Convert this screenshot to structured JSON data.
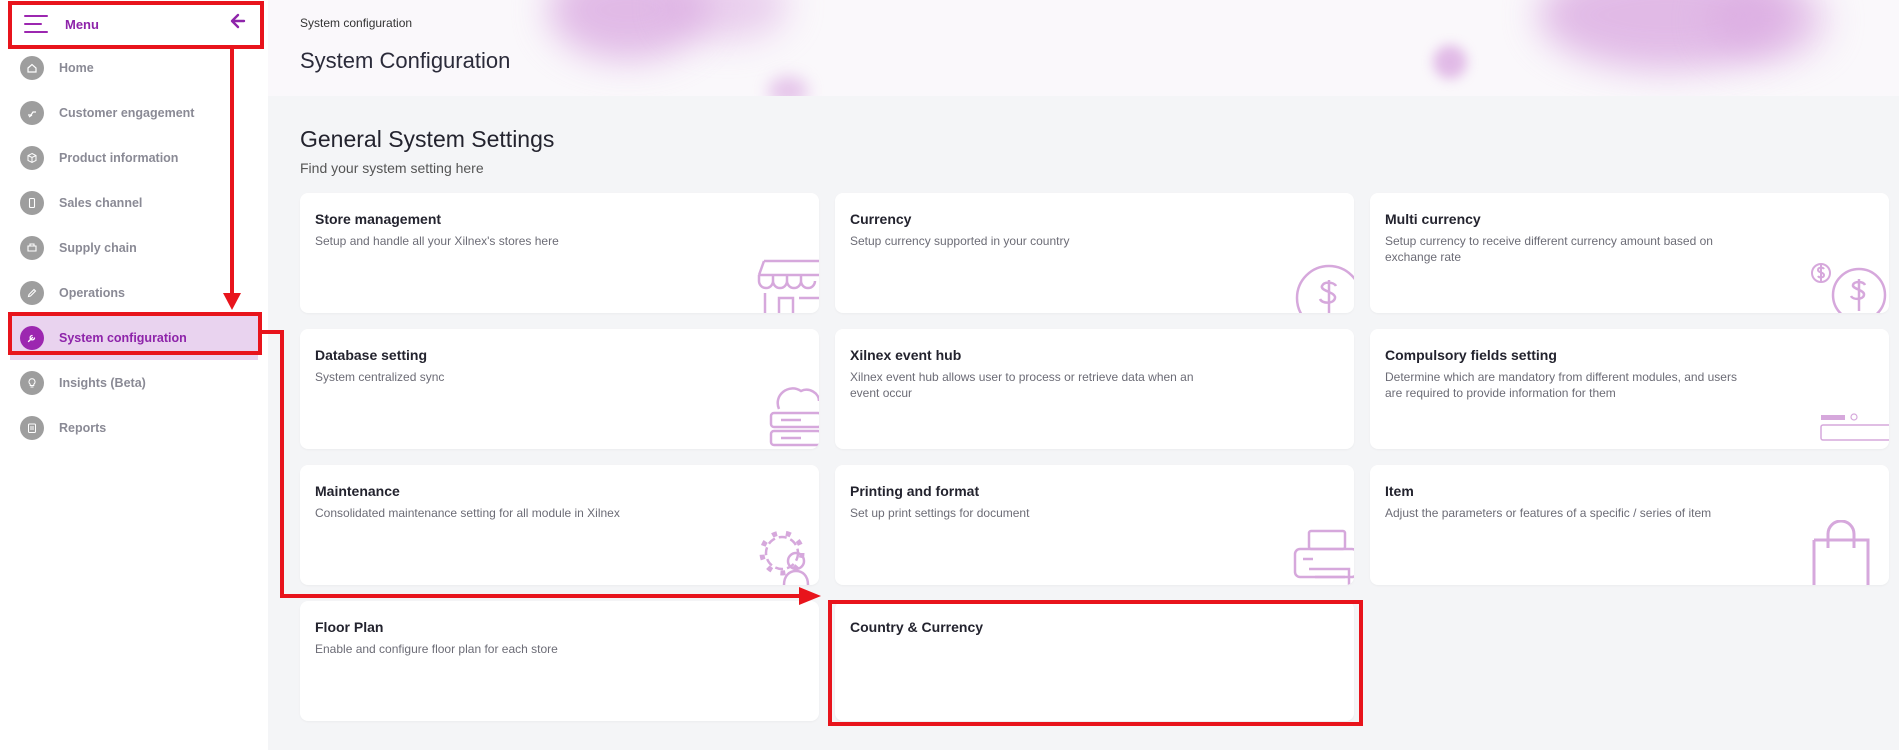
{
  "sidebar": {
    "menu_title": "Menu",
    "items": [
      {
        "label": "Home",
        "icon": "home-icon"
      },
      {
        "label": "Customer engagement",
        "icon": "handshake-icon"
      },
      {
        "label": "Product information",
        "icon": "cube-icon"
      },
      {
        "label": "Sales channel",
        "icon": "phone-icon"
      },
      {
        "label": "Supply chain",
        "icon": "truck-icon"
      },
      {
        "label": "Operations",
        "icon": "pen-icon"
      },
      {
        "label": "System configuration",
        "icon": "wrench-icon",
        "active": true
      },
      {
        "label": "Insights (Beta)",
        "icon": "lightbulb-icon"
      },
      {
        "label": "Reports",
        "icon": "clipboard-icon"
      }
    ]
  },
  "header": {
    "breadcrumb": "System configuration",
    "title": "System Configuration"
  },
  "section": {
    "title": "General System Settings",
    "subtitle": "Find your system setting here"
  },
  "cards": [
    {
      "title": "Store management",
      "desc": "Setup and handle all your Xilnex's stores here",
      "icon": "store-icon"
    },
    {
      "title": "Currency",
      "desc": "Setup currency supported in your country",
      "icon": "dollar-icon"
    },
    {
      "title": "Multi currency",
      "desc": "Setup currency to receive different currency amount based on exchange rate",
      "icon": "multi-dollar-icon"
    },
    {
      "title": "Database setting",
      "desc": "System centralized sync",
      "icon": "cloud-server-icon"
    },
    {
      "title": "Xilnex event hub",
      "desc": "Xilnex event hub allows user to process or retrieve data when an event occur",
      "icon": ""
    },
    {
      "title": "Compulsory fields setting",
      "desc": "Determine which are mandatory from different modules, and users are required to provide information for them",
      "icon": "form-field-icon"
    },
    {
      "title": "Maintenance",
      "desc": "Consolidated maintenance setting for all module in Xilnex",
      "icon": "gear-user-icon"
    },
    {
      "title": "Printing and format",
      "desc": "Set up print settings for document",
      "icon": "printer-icon"
    },
    {
      "title": "Item",
      "desc": "Adjust the parameters or features of a specific / series of item",
      "icon": "shopping-bag-icon"
    },
    {
      "title": "Floor Plan",
      "desc": "Enable and configure floor plan for each store",
      "icon": ""
    },
    {
      "title": "Country & Currency",
      "desc": "",
      "icon": ""
    }
  ],
  "colors": {
    "accent": "#9c27b0",
    "annotation": "#e8141c",
    "illustration": "#d6a8dc"
  }
}
